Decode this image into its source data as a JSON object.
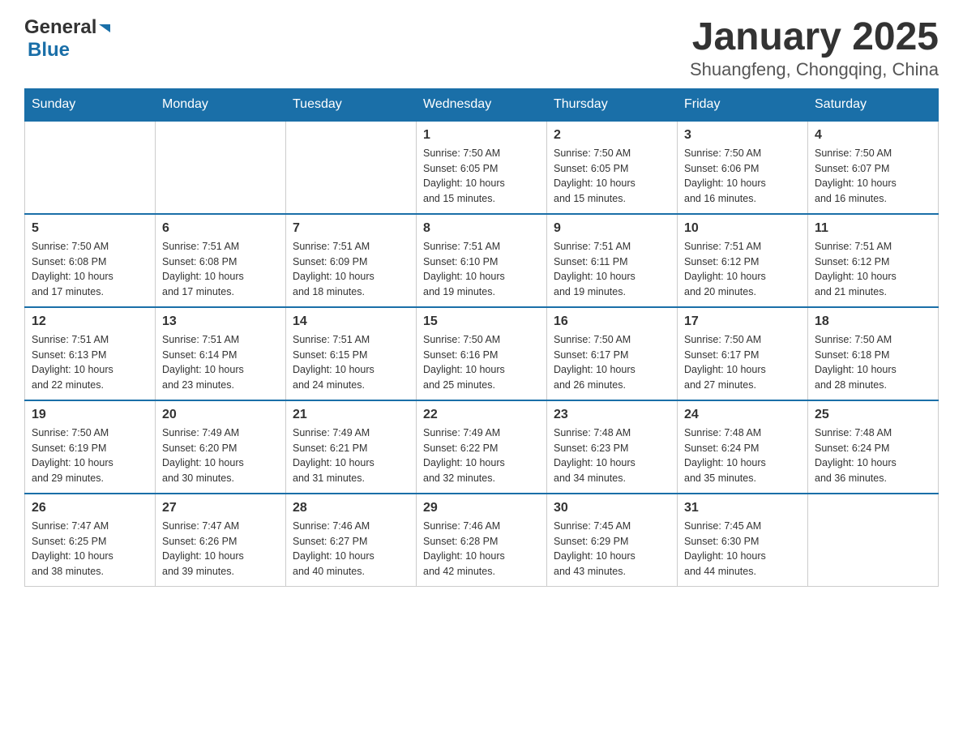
{
  "header": {
    "logo_general": "General",
    "logo_blue": "Blue",
    "title": "January 2025",
    "subtitle": "Shuangfeng, Chongqing, China"
  },
  "calendar": {
    "days_of_week": [
      "Sunday",
      "Monday",
      "Tuesday",
      "Wednesday",
      "Thursday",
      "Friday",
      "Saturday"
    ],
    "weeks": [
      [
        {
          "day": "",
          "info": ""
        },
        {
          "day": "",
          "info": ""
        },
        {
          "day": "",
          "info": ""
        },
        {
          "day": "1",
          "info": "Sunrise: 7:50 AM\nSunset: 6:05 PM\nDaylight: 10 hours\nand 15 minutes."
        },
        {
          "day": "2",
          "info": "Sunrise: 7:50 AM\nSunset: 6:05 PM\nDaylight: 10 hours\nand 15 minutes."
        },
        {
          "day": "3",
          "info": "Sunrise: 7:50 AM\nSunset: 6:06 PM\nDaylight: 10 hours\nand 16 minutes."
        },
        {
          "day": "4",
          "info": "Sunrise: 7:50 AM\nSunset: 6:07 PM\nDaylight: 10 hours\nand 16 minutes."
        }
      ],
      [
        {
          "day": "5",
          "info": "Sunrise: 7:50 AM\nSunset: 6:08 PM\nDaylight: 10 hours\nand 17 minutes."
        },
        {
          "day": "6",
          "info": "Sunrise: 7:51 AM\nSunset: 6:08 PM\nDaylight: 10 hours\nand 17 minutes."
        },
        {
          "day": "7",
          "info": "Sunrise: 7:51 AM\nSunset: 6:09 PM\nDaylight: 10 hours\nand 18 minutes."
        },
        {
          "day": "8",
          "info": "Sunrise: 7:51 AM\nSunset: 6:10 PM\nDaylight: 10 hours\nand 19 minutes."
        },
        {
          "day": "9",
          "info": "Sunrise: 7:51 AM\nSunset: 6:11 PM\nDaylight: 10 hours\nand 19 minutes."
        },
        {
          "day": "10",
          "info": "Sunrise: 7:51 AM\nSunset: 6:12 PM\nDaylight: 10 hours\nand 20 minutes."
        },
        {
          "day": "11",
          "info": "Sunrise: 7:51 AM\nSunset: 6:12 PM\nDaylight: 10 hours\nand 21 minutes."
        }
      ],
      [
        {
          "day": "12",
          "info": "Sunrise: 7:51 AM\nSunset: 6:13 PM\nDaylight: 10 hours\nand 22 minutes."
        },
        {
          "day": "13",
          "info": "Sunrise: 7:51 AM\nSunset: 6:14 PM\nDaylight: 10 hours\nand 23 minutes."
        },
        {
          "day": "14",
          "info": "Sunrise: 7:51 AM\nSunset: 6:15 PM\nDaylight: 10 hours\nand 24 minutes."
        },
        {
          "day": "15",
          "info": "Sunrise: 7:50 AM\nSunset: 6:16 PM\nDaylight: 10 hours\nand 25 minutes."
        },
        {
          "day": "16",
          "info": "Sunrise: 7:50 AM\nSunset: 6:17 PM\nDaylight: 10 hours\nand 26 minutes."
        },
        {
          "day": "17",
          "info": "Sunrise: 7:50 AM\nSunset: 6:17 PM\nDaylight: 10 hours\nand 27 minutes."
        },
        {
          "day": "18",
          "info": "Sunrise: 7:50 AM\nSunset: 6:18 PM\nDaylight: 10 hours\nand 28 minutes."
        }
      ],
      [
        {
          "day": "19",
          "info": "Sunrise: 7:50 AM\nSunset: 6:19 PM\nDaylight: 10 hours\nand 29 minutes."
        },
        {
          "day": "20",
          "info": "Sunrise: 7:49 AM\nSunset: 6:20 PM\nDaylight: 10 hours\nand 30 minutes."
        },
        {
          "day": "21",
          "info": "Sunrise: 7:49 AM\nSunset: 6:21 PM\nDaylight: 10 hours\nand 31 minutes."
        },
        {
          "day": "22",
          "info": "Sunrise: 7:49 AM\nSunset: 6:22 PM\nDaylight: 10 hours\nand 32 minutes."
        },
        {
          "day": "23",
          "info": "Sunrise: 7:48 AM\nSunset: 6:23 PM\nDaylight: 10 hours\nand 34 minutes."
        },
        {
          "day": "24",
          "info": "Sunrise: 7:48 AM\nSunset: 6:24 PM\nDaylight: 10 hours\nand 35 minutes."
        },
        {
          "day": "25",
          "info": "Sunrise: 7:48 AM\nSunset: 6:24 PM\nDaylight: 10 hours\nand 36 minutes."
        }
      ],
      [
        {
          "day": "26",
          "info": "Sunrise: 7:47 AM\nSunset: 6:25 PM\nDaylight: 10 hours\nand 38 minutes."
        },
        {
          "day": "27",
          "info": "Sunrise: 7:47 AM\nSunset: 6:26 PM\nDaylight: 10 hours\nand 39 minutes."
        },
        {
          "day": "28",
          "info": "Sunrise: 7:46 AM\nSunset: 6:27 PM\nDaylight: 10 hours\nand 40 minutes."
        },
        {
          "day": "29",
          "info": "Sunrise: 7:46 AM\nSunset: 6:28 PM\nDaylight: 10 hours\nand 42 minutes."
        },
        {
          "day": "30",
          "info": "Sunrise: 7:45 AM\nSunset: 6:29 PM\nDaylight: 10 hours\nand 43 minutes."
        },
        {
          "day": "31",
          "info": "Sunrise: 7:45 AM\nSunset: 6:30 PM\nDaylight: 10 hours\nand 44 minutes."
        },
        {
          "day": "",
          "info": ""
        }
      ]
    ]
  }
}
